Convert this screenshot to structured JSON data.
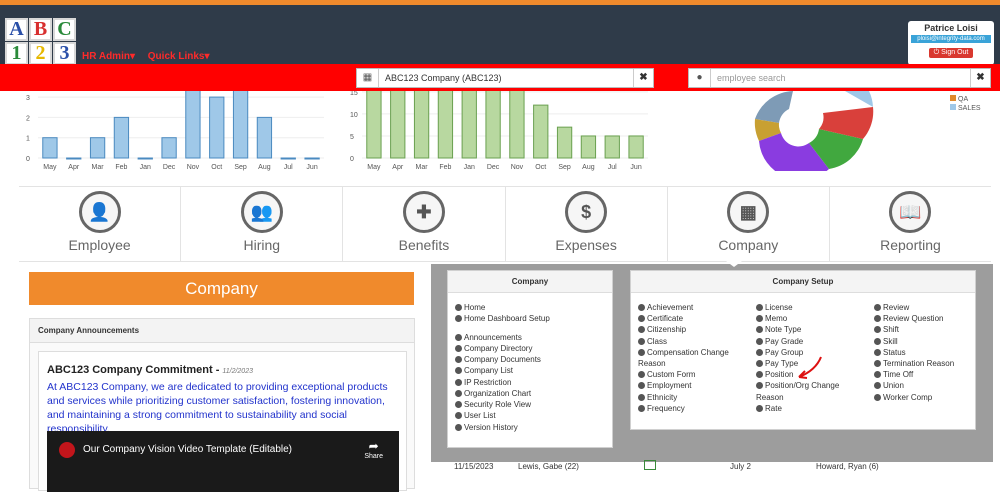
{
  "header": {
    "logo_letters": [
      "A",
      "B",
      "C",
      "1",
      "2",
      "3"
    ],
    "nav": [
      "HR Admin",
      "Quick Links"
    ],
    "user": {
      "name": "Patrice Loisi",
      "email": "ploisi@integrity-data.com",
      "signout": "Sign Out"
    }
  },
  "search": {
    "company_value": "ABC123 Company (ABC123)",
    "employee_placeholder": "employee search"
  },
  "charts": {
    "left": {
      "y_ticks": [
        "3",
        "2",
        "1",
        "0"
      ],
      "months": [
        "May",
        "Apr",
        "Mar",
        "Feb",
        "Jan",
        "Dec",
        "Nov",
        "Oct",
        "Sep",
        "Aug",
        "Jul",
        "Jun"
      ]
    },
    "middle": {
      "y_ticks": [
        "15",
        "10",
        "5",
        "0"
      ],
      "months": [
        "May",
        "Apr",
        "Mar",
        "Feb",
        "Jan",
        "Dec",
        "Nov",
        "Oct",
        "Sep",
        "Aug",
        "Jul",
        "Jun"
      ]
    },
    "legend": [
      "QA",
      "SALES"
    ]
  },
  "chart_data": [
    {
      "type": "bar",
      "categories": [
        "May",
        "Apr",
        "Mar",
        "Feb",
        "Jan",
        "Dec",
        "Nov",
        "Oct",
        "Sep",
        "Aug",
        "Jul",
        "Jun"
      ],
      "values": [
        1,
        0,
        1,
        2,
        0,
        1,
        4,
        3,
        4,
        2,
        0,
        0
      ],
      "ylim": [
        0,
        3
      ]
    },
    {
      "type": "bar",
      "categories": [
        "May",
        "Apr",
        "Mar",
        "Feb",
        "Jan",
        "Dec",
        "Nov",
        "Oct",
        "Sep",
        "Aug",
        "Jul",
        "Jun"
      ],
      "values": [
        17,
        17,
        17,
        17,
        17,
        17,
        17,
        12,
        7,
        5,
        5,
        5
      ],
      "ylim": [
        0,
        15
      ]
    }
  ],
  "tiles": [
    "Employee",
    "Hiring",
    "Benefits",
    "Expenses",
    "Company",
    "Reporting"
  ],
  "company_title": "Company",
  "announcements": {
    "header": "Company Announcements",
    "title": "ABC123 Company Commitment -",
    "date": "11/2/2023",
    "body": "At ABC123 Company, we are dedicated to providing exceptional products and services while prioritizing customer satisfaction, fostering innovation, and maintaining a strong commitment to sustainability and social responsibility.",
    "video_title": "Our Company Vision Video Template (Editable)",
    "video_share": "Share"
  },
  "menu_company": {
    "title": "Company",
    "items": [
      "Home",
      "Home Dashboard Setup",
      "Announcements",
      "Company Directory",
      "Company Documents",
      "Company List",
      "IP Restriction",
      "Organization Chart",
      "Security Role View",
      "User List",
      "Version History"
    ]
  },
  "menu_setup": {
    "title": "Company Setup",
    "col1": [
      "Achievement",
      "Certificate",
      "Citizenship",
      "Class",
      "Compensation Change",
      "Reason",
      "Custom Form",
      "Employment",
      "Ethnicity",
      "Frequency"
    ],
    "col2": [
      "License",
      "Memo",
      "Note Type",
      "Pay Grade",
      "Pay Group",
      "Pay Type",
      "Position",
      "Position/Org Change",
      "Reason",
      "Rate"
    ],
    "col3": [
      "Review",
      "Review Question",
      "Shift",
      "Skill",
      "Status",
      "Termination Reason",
      "Time Off",
      "Union",
      "Worker Comp"
    ]
  },
  "bottom": {
    "date1": "11/15/2023",
    "name1": "Lewis, Gabe (22)",
    "date2": "July 2",
    "name2": "Howard, Ryan (6)"
  },
  "colors": {
    "orange": "#f08a2c",
    "red": "#ff0000",
    "dark": "#2f3b49",
    "bar_blue": "#9fc8e8",
    "bar_green": "#b8d8a0"
  }
}
